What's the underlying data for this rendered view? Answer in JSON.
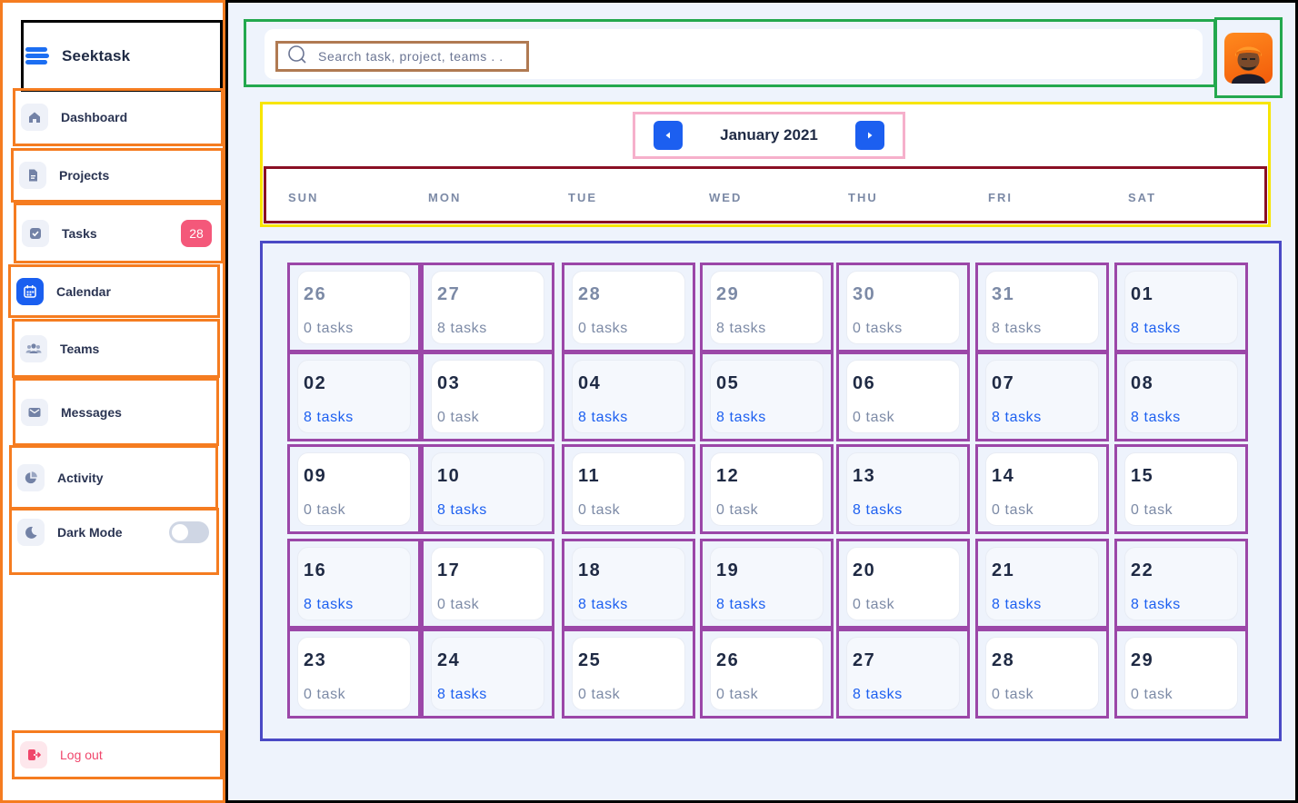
{
  "brand": {
    "name": "Seektask"
  },
  "nav": [
    {
      "label": "Dashboard",
      "icon": "home-icon"
    },
    {
      "label": "Projects",
      "icon": "document-icon"
    },
    {
      "label": "Tasks",
      "icon": "check-square-icon",
      "badge": "28"
    },
    {
      "label": "Calendar",
      "icon": "calendar-icon",
      "active": true
    },
    {
      "label": "Teams",
      "icon": "users-icon"
    },
    {
      "label": "Messages",
      "icon": "mail-icon"
    },
    {
      "label": "Activity",
      "icon": "pie-chart-icon"
    },
    {
      "label": "Dark Mode",
      "icon": "moon-icon",
      "toggle": false
    }
  ],
  "logout": {
    "label": "Log out",
    "icon": "logout-icon"
  },
  "search": {
    "placeholder": "Search task, project, teams . ."
  },
  "calendar": {
    "month": "January 2021",
    "weekdays": [
      "SUN",
      "MON",
      "TUE",
      "WED",
      "THU",
      "FRI",
      "SAT"
    ],
    "days": [
      {
        "num": "26",
        "tasks": "0 tasks",
        "muted": true
      },
      {
        "num": "27",
        "tasks": "8 tasks",
        "muted": true
      },
      {
        "num": "28",
        "tasks": "0 tasks",
        "muted": true
      },
      {
        "num": "29",
        "tasks": "8 tasks",
        "muted": true
      },
      {
        "num": "30",
        "tasks": "0 tasks",
        "muted": true
      },
      {
        "num": "31",
        "tasks": "8 tasks",
        "muted": true
      },
      {
        "num": "01",
        "tasks": "8 tasks",
        "has": true
      },
      {
        "num": "02",
        "tasks": "8 tasks",
        "has": true
      },
      {
        "num": "03",
        "tasks": "0 task"
      },
      {
        "num": "04",
        "tasks": "8 tasks",
        "has": true
      },
      {
        "num": "05",
        "tasks": "8 tasks",
        "has": true
      },
      {
        "num": "06",
        "tasks": "0 task"
      },
      {
        "num": "07",
        "tasks": "8 tasks",
        "has": true
      },
      {
        "num": "08",
        "tasks": "8 tasks",
        "has": true
      },
      {
        "num": "09",
        "tasks": "0 task"
      },
      {
        "num": "10",
        "tasks": "8 tasks",
        "has": true
      },
      {
        "num": "11",
        "tasks": "0 task"
      },
      {
        "num": "12",
        "tasks": "0 task"
      },
      {
        "num": "13",
        "tasks": "8 tasks",
        "has": true
      },
      {
        "num": "14",
        "tasks": "0 task"
      },
      {
        "num": "15",
        "tasks": "0 task"
      },
      {
        "num": "16",
        "tasks": "8 tasks",
        "has": true
      },
      {
        "num": "17",
        "tasks": "0 task"
      },
      {
        "num": "18",
        "tasks": "8 tasks",
        "has": true
      },
      {
        "num": "19",
        "tasks": "8 tasks",
        "has": true
      },
      {
        "num": "20",
        "tasks": "0 task"
      },
      {
        "num": "21",
        "tasks": "8 tasks",
        "has": true
      },
      {
        "num": "22",
        "tasks": "8 tasks",
        "has": true
      },
      {
        "num": "23",
        "tasks": "0 task"
      },
      {
        "num": "24",
        "tasks": "8 tasks",
        "has": true
      },
      {
        "num": "25",
        "tasks": "0 task"
      },
      {
        "num": "26",
        "tasks": "0 task"
      },
      {
        "num": "27",
        "tasks": "8 tasks",
        "has": true
      },
      {
        "num": "28",
        "tasks": "0 task"
      },
      {
        "num": "29",
        "tasks": "0 task"
      }
    ]
  },
  "colors": {
    "accent": "#1c5ff0",
    "badge": "#f4587a",
    "logout": "#f0466b",
    "background": "#eef3fc"
  }
}
